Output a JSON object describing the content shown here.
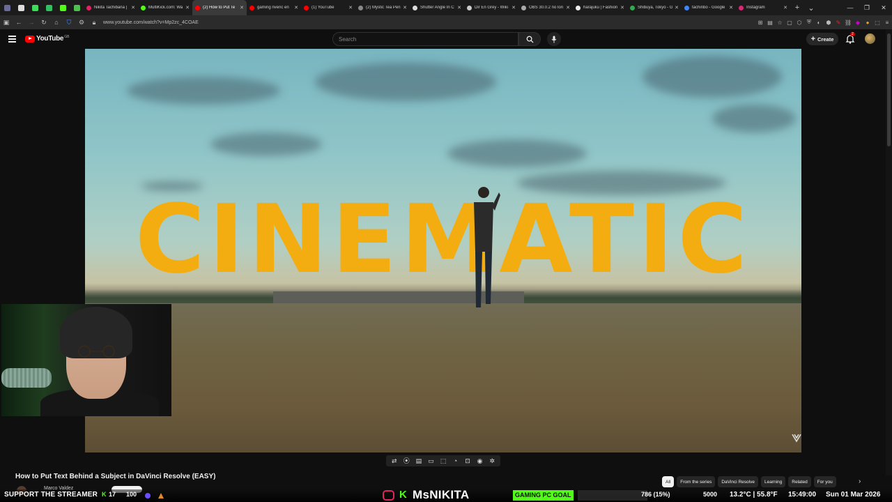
{
  "browser": {
    "pinned_tabs": [
      {
        "icon": "pinned-tab-1-icon",
        "color": "#6b6b9a"
      },
      {
        "icon": "x-icon",
        "color": "#dddddd"
      },
      {
        "icon": "pinned-tab-3-icon",
        "color": "#3ddc5a"
      },
      {
        "icon": "pinned-tab-4-icon",
        "color": "#30c060"
      },
      {
        "icon": "kick-icon",
        "color": "#53fc18"
      },
      {
        "icon": "pinned-tab-6-icon",
        "color": "#4fc04f"
      }
    ],
    "tabs": [
      {
        "title": "Nikita Tachibana | ",
        "favicon": "#e0245e"
      },
      {
        "title": "MultiKick.com: Wa",
        "favicon": "#53fc18"
      },
      {
        "title": "(2) How to Put Te",
        "favicon": "#ff0000"
      },
      {
        "title": "gaming nvenc en",
        "favicon": "#ff0000"
      },
      {
        "title": "(1) YouTube",
        "favicon": "#ff0000"
      },
      {
        "title": "(2) Mystic Tea Pen",
        "favicon": "#888888"
      },
      {
        "title": "Shutter Angle In C",
        "favicon": "#dddddd"
      },
      {
        "title": "Dir En Grey - Wiki",
        "favicon": "#cccccc"
      },
      {
        "title": "OBS 30.0.2 no lon",
        "favicon": "#aaaaaa"
      },
      {
        "title": "harajuku | Fashion",
        "favicon": "#eeeeee"
      },
      {
        "title": "Shibuya, Tokyo - G",
        "favicon": "#34a853"
      },
      {
        "title": "tachinbo - Google",
        "favicon": "#4285f4"
      },
      {
        "title": "Instagram",
        "favicon": "#d62976"
      }
    ],
    "active_tab_index": 2,
    "new_tab_symbol": "+",
    "dropdown_symbol": "⌄",
    "window_minimize": "—",
    "window_restore": "❐",
    "window_close": "✕",
    "url": "www.youtube.com/watch?v=Mp2zc_4COAE"
  },
  "youtube": {
    "logo_text": "YouTube",
    "logo_sup": "GB",
    "search_placeholder": "Search",
    "create_label": "Create",
    "notification_count": "2",
    "video_text_overlay": "CINEMATIC",
    "video_title": "How to Put Text Behind a Subject in DaVinci Resolve (EASY)",
    "channel_name": "Marco Valdez",
    "chips": [
      {
        "label": "All",
        "active": true
      },
      {
        "label": "From the series",
        "active": false
      },
      {
        "label": "DaVinci Resolve",
        "active": false
      },
      {
        "label": "Learning",
        "active": false
      },
      {
        "label": "Related",
        "active": false
      },
      {
        "label": "For you",
        "active": false
      }
    ],
    "chip_next_symbol": "›",
    "player_buttons": [
      "loop-icon",
      "audio-icon",
      "subtitles-icon",
      "miniplayer-icon",
      "theater-icon",
      "speed-icon",
      "screenshot-icon",
      "camera-icon",
      "settings-icon"
    ],
    "player_glyphs": [
      "⇄",
      "⦿",
      "▤",
      "▭",
      "⬚",
      "◔",
      "⊡",
      "◉",
      "✲"
    ]
  },
  "stream_overlay": {
    "support_text": "SUPPORT THE STREAMER",
    "kick_symbol": "K",
    "sub_count": "17",
    "sub_goal": "100",
    "kick_logo": "K",
    "streamer_name": "MsNIKITA",
    "goal_label": "GAMING PC GOAL",
    "goal_progress": "786 (15%)",
    "goal_target": "5000",
    "weather": "13.2°C | 55.8°F",
    "clock": "15:49:00",
    "date": "Sun 01 Mar 2026",
    "accent_colors": {
      "kick_green": "#53fc18",
      "gold_text": "#f3ad10"
    }
  }
}
